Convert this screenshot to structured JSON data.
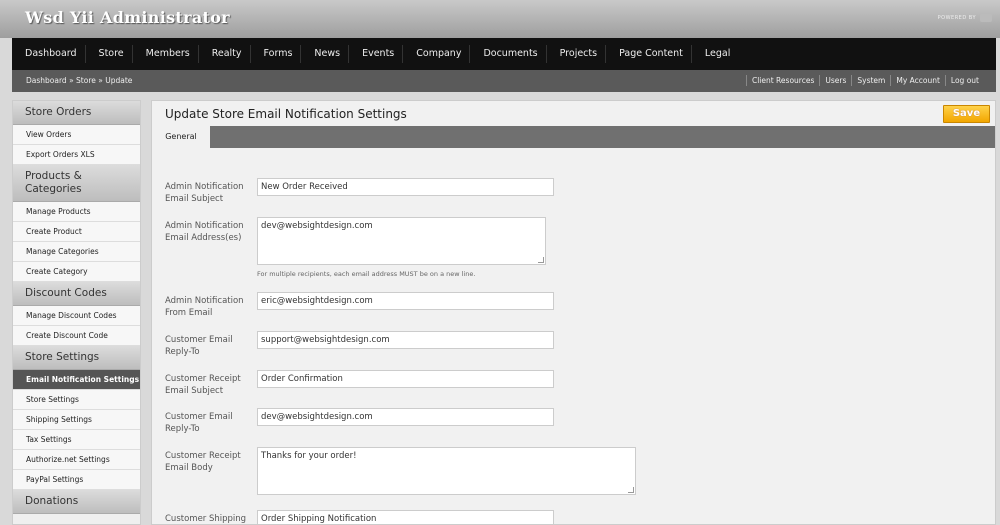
{
  "header": {
    "title": "Wsd Yii Administrator",
    "powered_by": "POWERED BY"
  },
  "nav": {
    "items": [
      "Dashboard",
      "Store",
      "Members",
      "Realty",
      "Forms",
      "News",
      "Events",
      "Company",
      "Documents",
      "Projects",
      "Page Content",
      "Legal"
    ]
  },
  "subbar": {
    "breadcrumb": "Dashboard » Store » Update",
    "links": [
      "Client Resources",
      "Users",
      "System",
      "My Account",
      "Log out"
    ]
  },
  "sidebar": {
    "sections": [
      {
        "title": "Store Orders",
        "items": [
          "View Orders",
          "Export Orders XLS"
        ]
      },
      {
        "title": "Products & Categories",
        "items": [
          "Manage Products",
          "Create Product",
          "Manage Categories",
          "Create Category"
        ]
      },
      {
        "title": "Discount Codes",
        "items": [
          "Manage Discount Codes",
          "Create Discount Code"
        ]
      },
      {
        "title": "Store Settings",
        "items": [
          "Email Notification Settings",
          "Store Settings",
          "Shipping Settings",
          "Tax Settings",
          "Authorize.net Settings",
          "PayPal Settings"
        ]
      },
      {
        "title": "Donations",
        "items": []
      }
    ],
    "active_item": "Email Notification Settings"
  },
  "content": {
    "title": "Update Store Email Notification Settings",
    "save_label": "Save",
    "tab_label": "General",
    "fields": [
      {
        "label": "Admin Notification Email Subject",
        "value": "New Order Received"
      },
      {
        "label": "Admin Notification Email Address(es)",
        "value": "dev@websightdesign.com"
      },
      {
        "label": "Admin Notification From Email",
        "value": "eric@websightdesign.com"
      },
      {
        "label": "Customer Email Reply-To",
        "value": "support@websightdesign.com"
      },
      {
        "label": "Customer Receipt Email Subject",
        "value": "Order Confirmation"
      },
      {
        "label": "Customer Email Reply-To",
        "value": "dev@websightdesign.com"
      },
      {
        "label": "Customer Receipt Email Body",
        "value": "Thanks for your order!"
      },
      {
        "label": "Customer Shipping",
        "value": "Order Shipping Notification"
      }
    ],
    "hint": "For multiple recipients, each email address MUST be on a new line."
  }
}
